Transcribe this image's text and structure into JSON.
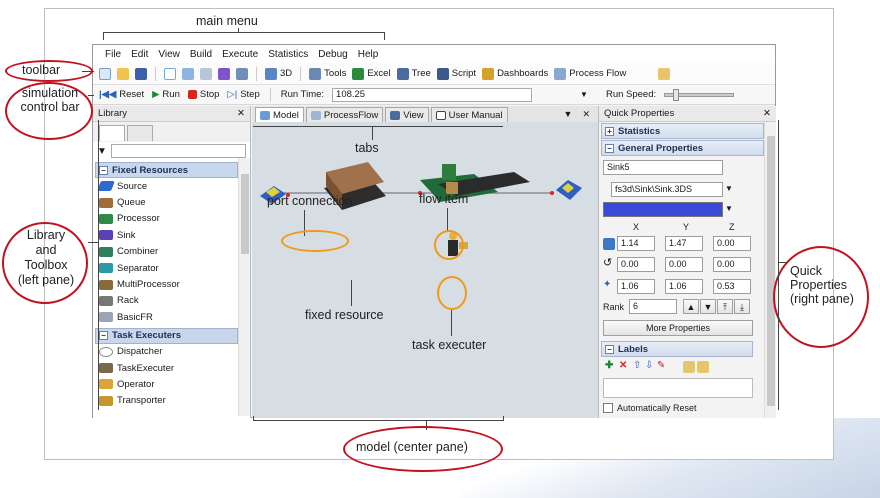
{
  "annotations": {
    "main_menu": "main menu",
    "toolbar": "toolbar",
    "sim_bar": "simulation control bar",
    "library": "Library and Toolbox (left pane)",
    "tabs": "tabs",
    "port_connection": "port connection",
    "flow_item": "flow item",
    "fixed_resource": "fixed resource",
    "task_executer": "task executer",
    "quick_props": "Quick Properties (right pane)",
    "model_center": "model (center pane)"
  },
  "menu": [
    "File",
    "Edit",
    "View",
    "Build",
    "Execute",
    "Statistics",
    "Debug",
    "Help"
  ],
  "toolbar": {
    "btn_3d": "3D",
    "tools": "Tools",
    "excel": "Excel",
    "tree": "Tree",
    "script": "Script",
    "dashboards": "Dashboards",
    "process_flow": "Process Flow"
  },
  "simbar": {
    "reset": "Reset",
    "run": "Run",
    "stop": "Stop",
    "step": "Step",
    "run_time_label": "Run Time:",
    "run_time_value": "108.25",
    "run_speed_label": "Run Speed:"
  },
  "library": {
    "title": "Library",
    "groups": [
      {
        "name": "Fixed Resources",
        "items": [
          "Source",
          "Queue",
          "Processor",
          "Sink",
          "Combiner",
          "Separator",
          "MultiProcessor",
          "Rack",
          "BasicFR"
        ]
      },
      {
        "name": "Task Executers",
        "items": [
          "Dispatcher",
          "TaskExecuter",
          "Operator",
          "Transporter"
        ]
      }
    ]
  },
  "center": {
    "tabs": [
      "Model",
      "ProcessFlow",
      "View",
      "User Manual"
    ]
  },
  "quick_properties": {
    "title": "Quick Properties",
    "statistics": "Statistics",
    "general": "General Properties",
    "name": "Sink5",
    "shape": "fs3d\\Sink\\Sink.3DS",
    "color": "#3a49d8",
    "axes": [
      "X",
      "Y",
      "Z"
    ],
    "position": [
      "1.14",
      "1.47",
      "0.00"
    ],
    "rotation": [
      "0.00",
      "0.00",
      "0.00"
    ],
    "size": [
      "1.06",
      "1.06",
      "0.53"
    ],
    "rank_label": "Rank",
    "rank_value": "6",
    "more_properties": "More Properties",
    "labels": "Labels",
    "auto_reset": "Automatically Reset"
  }
}
